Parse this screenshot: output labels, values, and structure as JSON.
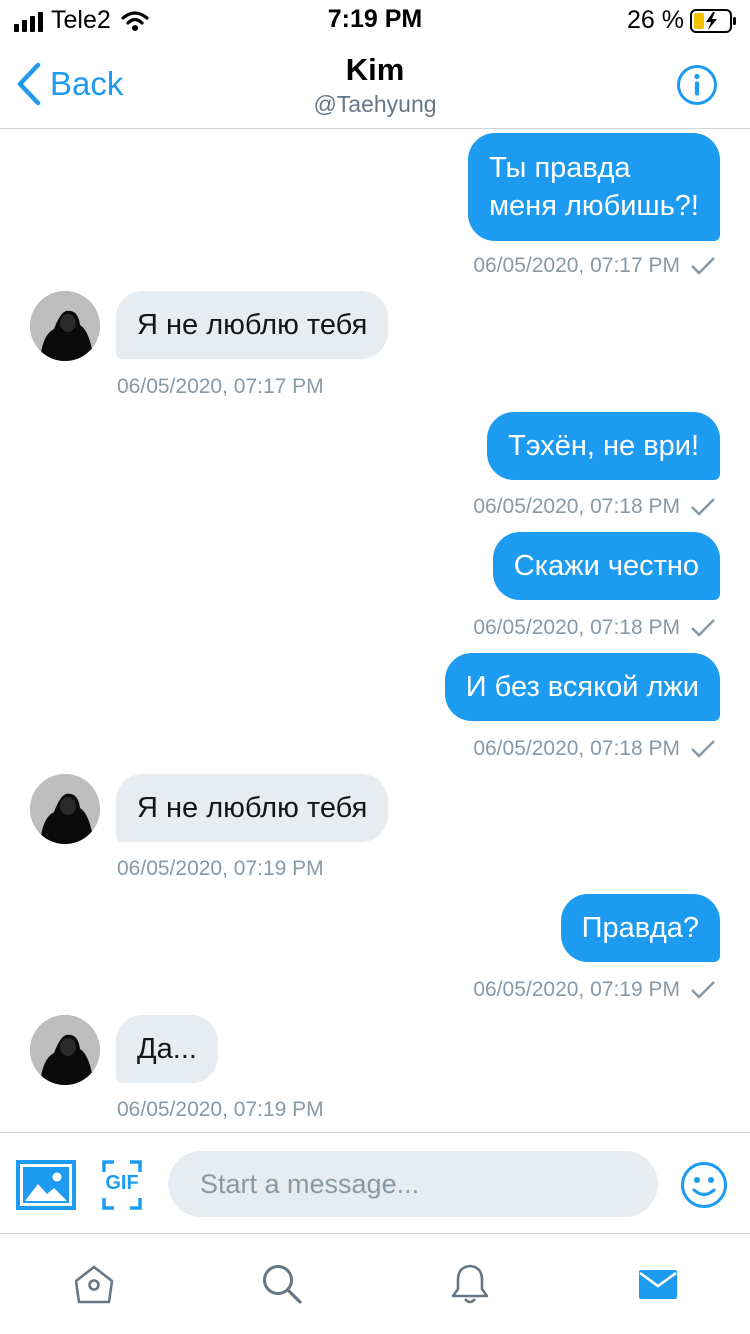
{
  "status_bar": {
    "carrier": "Tele2",
    "time": "7:19 PM",
    "battery_percent": "26 %"
  },
  "header": {
    "back_label": "Back",
    "title": "Kim",
    "subtitle": "@Taehyung"
  },
  "colors": {
    "accent": "#1d9bf0",
    "incoming_bubble": "#e6ecf0",
    "timestamp": "#8899a6"
  },
  "messages": [
    {
      "direction": "out",
      "lines": [
        "Ты правда",
        "меня любишь?!"
      ],
      "timestamp": "06/05/2020, 07:17 PM"
    },
    {
      "direction": "in",
      "text": "Я не люблю тебя",
      "timestamp": "06/05/2020, 07:17 PM"
    },
    {
      "direction": "out",
      "text": "Тэхён, не ври!",
      "timestamp": "06/05/2020, 07:18 PM"
    },
    {
      "direction": "out",
      "text": "Скажи честно",
      "timestamp": "06/05/2020, 07:18 PM"
    },
    {
      "direction": "out",
      "text": "И без всякой лжи",
      "timestamp": "06/05/2020, 07:18 PM"
    },
    {
      "direction": "in",
      "text": "Я не люблю тебя",
      "timestamp": "06/05/2020, 07:19 PM"
    },
    {
      "direction": "out",
      "text": "Правда?",
      "timestamp": "06/05/2020, 07:19 PM"
    },
    {
      "direction": "in",
      "text": "Да...",
      "timestamp": "06/05/2020, 07:19 PM"
    }
  ],
  "composer": {
    "placeholder": "Start a message...",
    "gif_label": "GIF",
    "icons": [
      "image-icon",
      "gif-icon",
      "emoji-icon"
    ]
  },
  "tabbar": {
    "items": [
      "home-icon",
      "search-icon",
      "notifications-icon",
      "messages-icon"
    ],
    "active": "messages-icon"
  }
}
